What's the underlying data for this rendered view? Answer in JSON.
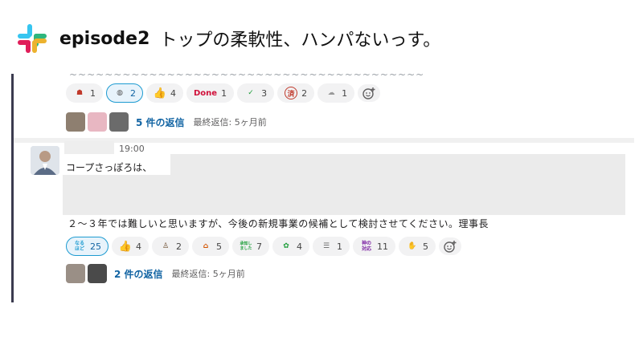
{
  "slide": {
    "title": "episode2",
    "subtitle": "トップの柔軟性、ハンパないっす。"
  },
  "message1": {
    "reactions": [
      {
        "icon": "curry-emoji-icon",
        "count": "1",
        "active": false
      },
      {
        "icon": "penguin-emoji-icon",
        "count": "2",
        "active": true
      },
      {
        "icon": "thumbs-up-icon",
        "count": "4",
        "active": false
      },
      {
        "icon": "done-emoji-icon",
        "label": "Done",
        "count": "1",
        "active": false
      },
      {
        "icon": "iine-emoji-icon",
        "count": "3",
        "active": false
      },
      {
        "icon": "sumi-emoji-icon",
        "label": "済",
        "count": "2",
        "active": false
      },
      {
        "icon": "sheep-emoji-icon",
        "count": "1",
        "active": false
      }
    ],
    "thread": {
      "reply_label": "5 件の返信",
      "last_reply": "最終返信: 5ヶ月前"
    }
  },
  "message2": {
    "timestamp": "19:00",
    "text_line1": "コープさっぽろは、",
    "text_line2": "２～３年では難しいと思いますが、今後の新規事業の候補として検討させてください。理事長",
    "reactions": [
      {
        "icon": "naruhodo-emoji-icon",
        "label": "なるほど",
        "count": "25",
        "active": true
      },
      {
        "icon": "thumbs-up-icon",
        "count": "4",
        "active": false
      },
      {
        "icon": "person-bowing-icon",
        "count": "2",
        "active": false
      },
      {
        "icon": "house-emoji-icon",
        "count": "5",
        "active": false
      },
      {
        "icon": "shouchi-emoji-icon",
        "label": "承知しました",
        "count": "7",
        "active": false
      },
      {
        "icon": "arigatou-emoji-icon",
        "count": "4",
        "active": false
      },
      {
        "icon": "kakunin-emoji-icon",
        "count": "1",
        "active": false
      },
      {
        "icon": "kami-taiou-emoji-icon",
        "label": "神の対応",
        "count": "11",
        "active": false
      },
      {
        "icon": "applause-emoji-icon",
        "count": "5",
        "active": false
      }
    ],
    "thread": {
      "reply_label": "2 件の返信",
      "last_reply": "最終返信: 5ヶ月前"
    }
  },
  "colors": {
    "link": "#1264a3",
    "active_border": "#1d9bd1",
    "active_bg": "#e8f3fb"
  }
}
